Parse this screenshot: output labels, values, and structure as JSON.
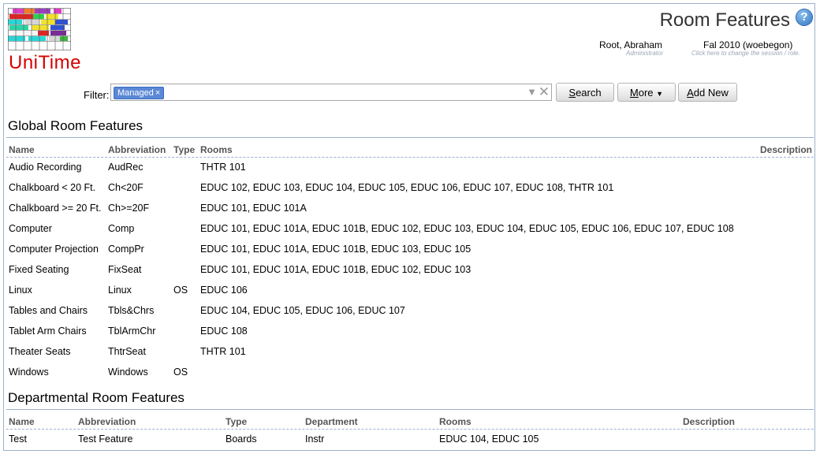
{
  "header": {
    "logo_text": "UniTime",
    "page_title": "Room Features",
    "help_glyph": "?",
    "user_name": "Root, Abraham",
    "user_role": "Administrator",
    "session_name": "Fal 2010 (woebegon)",
    "session_hint": "Click here to change the session / role."
  },
  "filter": {
    "label": "Filter:",
    "chip": "Managed",
    "chip_close": "×",
    "dropdown_glyph": "▼",
    "clear_glyph": "✕"
  },
  "buttons": {
    "search_key": "S",
    "search_rest": "earch",
    "more_key": "M",
    "more_rest": "ore",
    "more_arrow": "▼",
    "add_key": "A",
    "add_rest": "dd New"
  },
  "global": {
    "title": "Global Room Features",
    "headers": {
      "name": "Name",
      "abbreviation": "Abbreviation",
      "type": "Type",
      "rooms": "Rooms",
      "description": "Description"
    },
    "rows": [
      {
        "name": "Audio Recording",
        "abbr": "AudRec",
        "type": "",
        "rooms": "THTR 101"
      },
      {
        "name": "Chalkboard < 20 Ft.",
        "abbr": "Ch<20F",
        "type": "",
        "rooms": "EDUC 102, EDUC 103, EDUC 104, EDUC 105, EDUC 106, EDUC 107, EDUC 108, THTR 101"
      },
      {
        "name": "Chalkboard >= 20 Ft.",
        "abbr": "Ch>=20F",
        "type": "",
        "rooms": "EDUC 101, EDUC 101A"
      },
      {
        "name": "Computer",
        "abbr": "Comp",
        "type": "",
        "rooms": "EDUC 101, EDUC 101A, EDUC 101B, EDUC 102, EDUC 103, EDUC 104, EDUC 105, EDUC 106, EDUC 107, EDUC 108"
      },
      {
        "name": "Computer Projection",
        "abbr": "CompPr",
        "type": "",
        "rooms": "EDUC 101, EDUC 101A, EDUC 101B, EDUC 103, EDUC 105"
      },
      {
        "name": "Fixed Seating",
        "abbr": "FixSeat",
        "type": "",
        "rooms": "EDUC 101, EDUC 101A, EDUC 101B, EDUC 102, EDUC 103"
      },
      {
        "name": "Linux",
        "abbr": "Linux",
        "type": "OS",
        "rooms": "EDUC 106"
      },
      {
        "name": "Tables and Chairs",
        "abbr": "Tbls&Chrs",
        "type": "",
        "rooms": "EDUC 104, EDUC 105, EDUC 106, EDUC 107"
      },
      {
        "name": "Tablet Arm Chairs",
        "abbr": "TblArmChr",
        "type": "",
        "rooms": "EDUC 108"
      },
      {
        "name": "Theater Seats",
        "abbr": "ThtrSeat",
        "type": "",
        "rooms": "THTR 101"
      },
      {
        "name": "Windows",
        "abbr": "Windows",
        "type": "OS",
        "rooms": ""
      }
    ]
  },
  "departmental": {
    "title": "Departmental Room Features",
    "headers": {
      "name": "Name",
      "abbreviation": "Abbreviation",
      "type": "Type",
      "department": "Department",
      "rooms": "Rooms",
      "description": "Description"
    },
    "rows": [
      {
        "name": "Test",
        "abbr": "Test Feature",
        "type": "Boards",
        "department": "Instr",
        "rooms": "EDUC 104, EDUC 105"
      }
    ]
  },
  "colors": {
    "accent_line": "#9cb0ce",
    "chip": "#5b88d6",
    "logo_red": "#d80000"
  }
}
